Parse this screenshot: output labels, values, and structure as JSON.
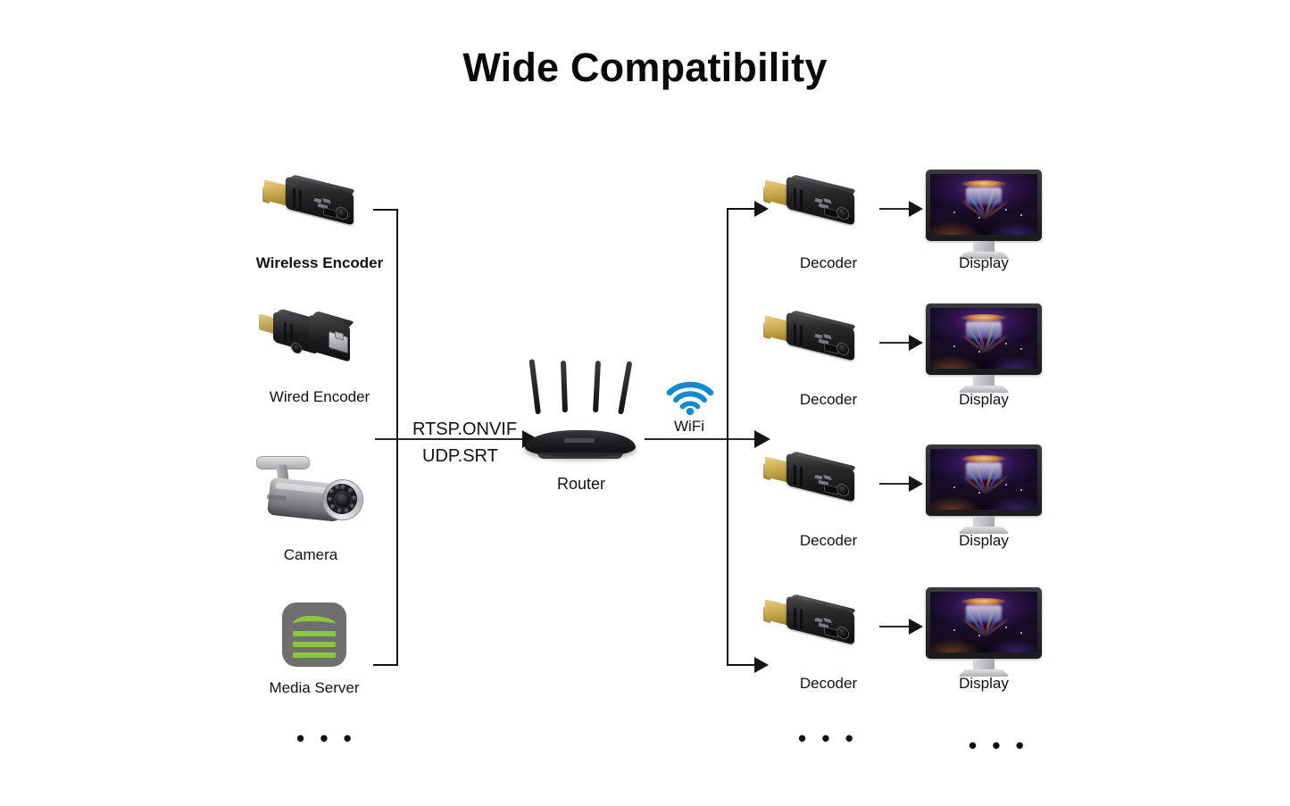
{
  "page": {
    "title": "Wide Compatibility",
    "background_color": "#ffffff",
    "text_color": "#111111"
  },
  "sources": {
    "ellipsis": "• • •",
    "items": [
      {
        "label": "Wireless Encoder",
        "icon": "hdmi-dongle-icon"
      },
      {
        "label": "Wired Encoder",
        "icon": "rj45-encoder-icon"
      },
      {
        "label": "Camera",
        "icon": "bullet-camera-icon"
      },
      {
        "label": "Media Server",
        "icon": "media-server-icon"
      }
    ]
  },
  "link": {
    "protocol_top": "RTSP.ONVIF",
    "protocol_bottom": "UDP.SRT"
  },
  "router": {
    "label": "Router",
    "icon": "wifi-router-icon"
  },
  "wifi": {
    "label": "WiFi",
    "icon": "wifi-icon",
    "color": "#1389d0"
  },
  "outputs": {
    "decoder_ellipsis": "• • •",
    "display_ellipsis": "• • •",
    "rows": [
      {
        "decoder_label": "Decoder",
        "display_label": "Display"
      },
      {
        "decoder_label": "Decoder",
        "display_label": "Display"
      },
      {
        "decoder_label": "Decoder",
        "display_label": "Display"
      },
      {
        "decoder_label": "Decoder",
        "display_label": "Display"
      }
    ]
  },
  "colors": {
    "accent_blue": "#1389d0",
    "server_green": "#8cc63e",
    "server_gray": "#6f6f6f",
    "line": "#111111"
  }
}
